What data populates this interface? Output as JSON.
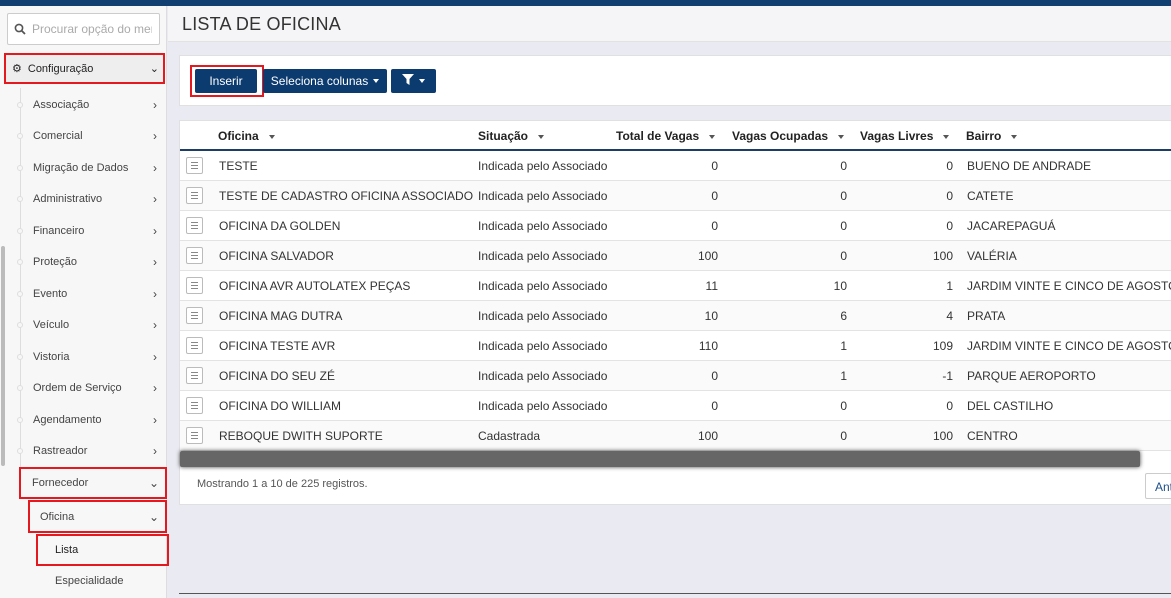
{
  "search": {
    "placeholder": "Procurar opção do menu"
  },
  "menu": {
    "top_label": "Configuração",
    "items": [
      {
        "label": "Associação"
      },
      {
        "label": "Comercial"
      },
      {
        "label": "Migração de Dados"
      },
      {
        "label": "Administrativo"
      },
      {
        "label": "Financeiro"
      },
      {
        "label": "Proteção"
      },
      {
        "label": "Evento"
      },
      {
        "label": "Veículo"
      },
      {
        "label": "Vistoria"
      },
      {
        "label": "Ordem de Serviço"
      },
      {
        "label": "Agendamento"
      },
      {
        "label": "Rastreador"
      }
    ],
    "fornecedor": "Fornecedor",
    "oficina": "Oficina",
    "lista": "Lista",
    "especialidade": "Especialidade"
  },
  "page": {
    "title": "LISTA DE OFICINA"
  },
  "toolbar": {
    "insert": "Inserir",
    "columns": "Seleciona colunas"
  },
  "table": {
    "headers": [
      "Oficina",
      "Situação",
      "Total de Vagas",
      "Vagas Ocupadas",
      "Vagas Livres",
      "Bairro"
    ],
    "rows": [
      [
        "TESTE",
        "Indicada pelo Associado",
        "0",
        "0",
        "0",
        "BUENO DE ANDRADE"
      ],
      [
        "TESTE DE CADASTRO OFICINA ASSOCIADO",
        "Indicada pelo Associado",
        "0",
        "0",
        "0",
        "CATETE"
      ],
      [
        "OFICINA DA GOLDEN",
        "Indicada pelo Associado",
        "0",
        "0",
        "0",
        "JACAREPAGUÁ"
      ],
      [
        "OFICINA SALVADOR",
        "Indicada pelo Associado",
        "100",
        "0",
        "100",
        "VALÉRIA"
      ],
      [
        "OFICINA AVR AUTOLATEX PEÇAS",
        "Indicada pelo Associado",
        "11",
        "10",
        "1",
        "JARDIM VINTE E CINCO DE AGOSTO"
      ],
      [
        "OFICINA MAG DUTRA",
        "Indicada pelo Associado",
        "10",
        "6",
        "4",
        "PRATA"
      ],
      [
        "OFICINA TESTE AVR",
        "Indicada pelo Associado",
        "110",
        "1",
        "109",
        "JARDIM VINTE E CINCO DE AGOSTO"
      ],
      [
        "OFICINA DO SEU ZÉ",
        "Indicada pelo Associado",
        "0",
        "1",
        "-1",
        "PARQUE AEROPORTO"
      ],
      [
        "OFICINA DO WILLIAM",
        "Indicada pelo Associado",
        "0",
        "0",
        "0",
        "DEL CASTILHO"
      ],
      [
        "REBOQUE DWITH SUPORTE",
        "Cadastrada",
        "100",
        "0",
        "100",
        "CENTRO"
      ]
    ],
    "footer": "Mostrando 1 a 10 de 225 registros.",
    "pager_prev": "Ant"
  },
  "colors": {
    "brand": "#0c3b6f",
    "highlight": "#e4191f"
  }
}
